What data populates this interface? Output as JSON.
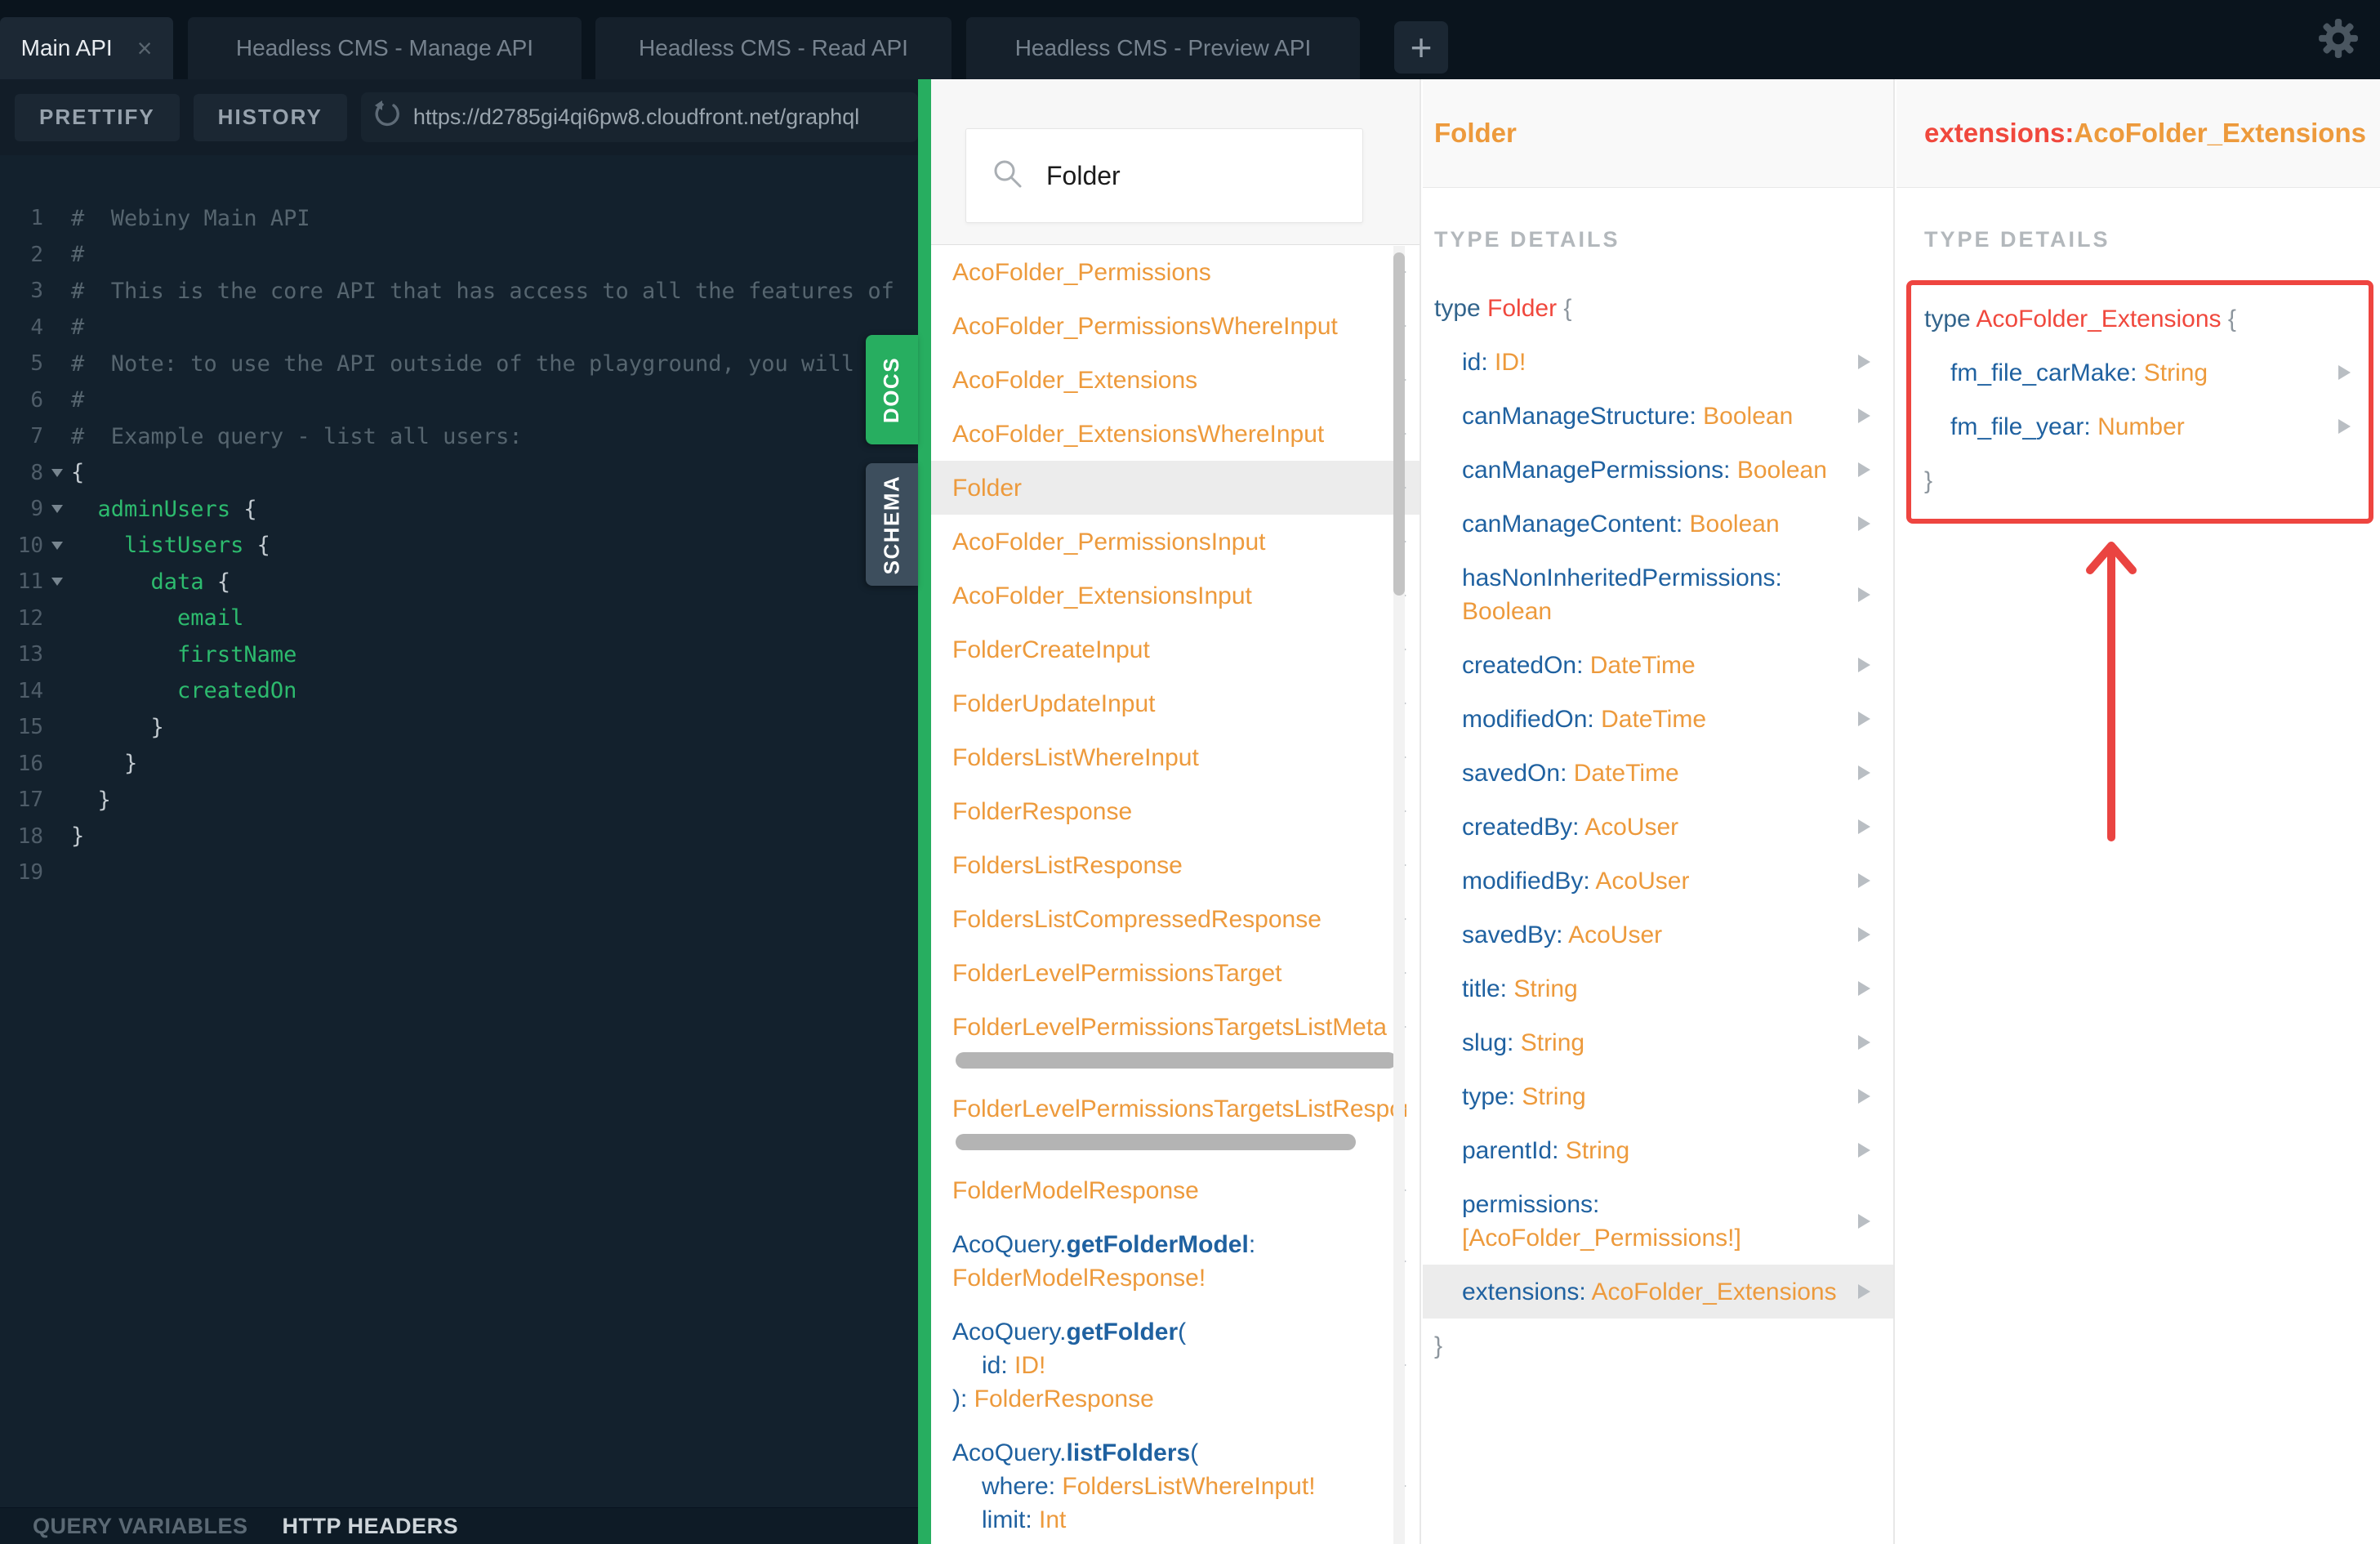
{
  "colors": {
    "accent_green": "#27ae60",
    "type_orange": "#ed9a3c",
    "field_blue": "#1f61a0",
    "keyword_red": "#f0483d",
    "highlight_red": "#ee4540",
    "editor_green": "#2dbb6e",
    "dark_bg": "#13212d"
  },
  "tabs": {
    "items": [
      {
        "label": "Main API",
        "active": true,
        "closable": true
      },
      {
        "label": "Headless CMS - Manage API",
        "active": false,
        "closable": false
      },
      {
        "label": "Headless CMS - Read API",
        "active": false,
        "closable": false
      },
      {
        "label": "Headless CMS - Preview API",
        "active": false,
        "closable": false
      }
    ],
    "close_label": "×",
    "add_label": "+"
  },
  "toolbar": {
    "prettify_label": "PRETTIFY",
    "history_label": "HISTORY",
    "url": "https://d2785gi4qi6pw8.cloudfront.net/graphql"
  },
  "footer": {
    "query_variables": "QUERY VARIABLES",
    "http_headers": "HTTP HEADERS"
  },
  "side_tabs": {
    "docs": "DOCS",
    "schema": "SCHEMA"
  },
  "editor": {
    "lines": [
      {
        "n": "1",
        "fold": false,
        "seg": [
          {
            "t": "#  Webiny Main API",
            "c": "cm"
          }
        ]
      },
      {
        "n": "2",
        "fold": false,
        "seg": [
          {
            "t": "#",
            "c": "cm"
          }
        ]
      },
      {
        "n": "3",
        "fold": false,
        "seg": [
          {
            "t": "#  This is the core API that has access to all the features of",
            "c": "cm"
          }
        ]
      },
      {
        "n": "4",
        "fold": false,
        "seg": [
          {
            "t": "#",
            "c": "cm"
          }
        ]
      },
      {
        "n": "5",
        "fold": false,
        "seg": [
          {
            "t": "#  Note: to use the API outside of the playground, you will need",
            "c": "cm"
          }
        ]
      },
      {
        "n": "6",
        "fold": false,
        "seg": [
          {
            "t": "#",
            "c": "cm"
          }
        ]
      },
      {
        "n": "7",
        "fold": false,
        "seg": [
          {
            "t": "#  Example query - list all users:",
            "c": "cm"
          }
        ]
      },
      {
        "n": "8",
        "fold": true,
        "seg": [
          {
            "t": "{",
            "c": "pn"
          }
        ]
      },
      {
        "n": "9",
        "fold": true,
        "seg": [
          {
            "t": "  ",
            "c": "pn"
          },
          {
            "t": "adminUsers",
            "c": "gr"
          },
          {
            "t": " {",
            "c": "pn"
          }
        ]
      },
      {
        "n": "10",
        "fold": true,
        "seg": [
          {
            "t": "    ",
            "c": "pn"
          },
          {
            "t": "listUsers",
            "c": "gr"
          },
          {
            "t": " {",
            "c": "pn"
          }
        ]
      },
      {
        "n": "11",
        "fold": true,
        "seg": [
          {
            "t": "      ",
            "c": "pn"
          },
          {
            "t": "data",
            "c": "gr"
          },
          {
            "t": " {",
            "c": "pn"
          }
        ]
      },
      {
        "n": "12",
        "fold": false,
        "seg": [
          {
            "t": "        ",
            "c": "pn"
          },
          {
            "t": "email",
            "c": "gr"
          }
        ]
      },
      {
        "n": "13",
        "fold": false,
        "seg": [
          {
            "t": "        ",
            "c": "pn"
          },
          {
            "t": "firstName",
            "c": "gr"
          }
        ]
      },
      {
        "n": "14",
        "fold": false,
        "seg": [
          {
            "t": "        ",
            "c": "pn"
          },
          {
            "t": "createdOn",
            "c": "gr"
          }
        ]
      },
      {
        "n": "15",
        "fold": false,
        "seg": [
          {
            "t": "      }",
            "c": "pn"
          }
        ]
      },
      {
        "n": "16",
        "fold": false,
        "seg": [
          {
            "t": "    }",
            "c": "pn"
          }
        ]
      },
      {
        "n": "17",
        "fold": false,
        "seg": [
          {
            "t": "  }",
            "c": "pn"
          }
        ]
      },
      {
        "n": "18",
        "fold": false,
        "seg": [
          {
            "t": "}",
            "c": "pn"
          }
        ]
      },
      {
        "n": "19",
        "fold": false,
        "seg": []
      }
    ]
  },
  "docs": {
    "search_value": "Folder",
    "list": [
      {
        "arrow": true,
        "lines": [
          {
            "seg": [
              {
                "t": "AcoFolder_Permissions",
                "c": "or"
              }
            ]
          }
        ]
      },
      {
        "arrow": true,
        "lines": [
          {
            "seg": [
              {
                "t": "AcoFolder_PermissionsWhereInput",
                "c": "or"
              }
            ]
          }
        ]
      },
      {
        "arrow": true,
        "lines": [
          {
            "seg": [
              {
                "t": "AcoFolder_Extensions",
                "c": "or"
              }
            ]
          }
        ]
      },
      {
        "arrow": true,
        "lines": [
          {
            "seg": [
              {
                "t": "AcoFolder_ExtensionsWhereInput",
                "c": "or"
              }
            ]
          }
        ]
      },
      {
        "arrow": true,
        "hl": true,
        "lines": [
          {
            "seg": [
              {
                "t": "Folder",
                "c": "or"
              }
            ]
          }
        ]
      },
      {
        "arrow": true,
        "lines": [
          {
            "seg": [
              {
                "t": "AcoFolder_PermissionsInput",
                "c": "or"
              }
            ]
          }
        ]
      },
      {
        "arrow": true,
        "lines": [
          {
            "seg": [
              {
                "t": "AcoFolder_ExtensionsInput",
                "c": "or"
              }
            ]
          }
        ]
      },
      {
        "arrow": true,
        "lines": [
          {
            "seg": [
              {
                "t": "FolderCreateInput",
                "c": "or"
              }
            ]
          }
        ]
      },
      {
        "arrow": true,
        "lines": [
          {
            "seg": [
              {
                "t": "FolderUpdateInput",
                "c": "or"
              }
            ]
          }
        ]
      },
      {
        "arrow": true,
        "lines": [
          {
            "seg": [
              {
                "t": "FoldersListWhereInput",
                "c": "or"
              }
            ]
          }
        ]
      },
      {
        "arrow": true,
        "lines": [
          {
            "seg": [
              {
                "t": "FolderResponse",
                "c": "or"
              }
            ]
          }
        ]
      },
      {
        "arrow": true,
        "lines": [
          {
            "seg": [
              {
                "t": "FoldersListResponse",
                "c": "or"
              }
            ]
          }
        ]
      },
      {
        "arrow": true,
        "lines": [
          {
            "seg": [
              {
                "t": "FoldersListCompressedResponse",
                "c": "or"
              }
            ]
          }
        ]
      },
      {
        "arrow": true,
        "lines": [
          {
            "seg": [
              {
                "t": "FolderLevelPermissionsTarget",
                "c": "or"
              }
            ]
          }
        ]
      },
      {
        "arrow": true,
        "hbar": true,
        "hbarw": 540,
        "lines": [
          {
            "seg": [
              {
                "t": "FolderLevelPermissionsTargetsListMeta",
                "c": "or"
              }
            ]
          }
        ]
      },
      {
        "arrow": true,
        "hbar": true,
        "hbarw": 490,
        "lines": [
          {
            "seg": [
              {
                "t": "FolderLevelPermissionsTargetsListResponse",
                "c": "or"
              }
            ]
          }
        ]
      },
      {
        "arrow": true,
        "lines": [
          {
            "seg": [
              {
                "t": "FolderModelResponse",
                "c": "or"
              }
            ]
          }
        ]
      },
      {
        "arrow": true,
        "lines": [
          {
            "seg": [
              {
                "t": "AcoQuery.",
                "c": "bl"
              },
              {
                "t": "getFolderModel",
                "c": "bb"
              },
              {
                "t": ":",
                "c": "bl"
              }
            ]
          },
          {
            "seg": [
              {
                "t": "FolderModelResponse!",
                "c": "or"
              }
            ]
          }
        ]
      },
      {
        "arrow": true,
        "lines": [
          {
            "seg": [
              {
                "t": "AcoQuery.",
                "c": "bl"
              },
              {
                "t": "getFolder",
                "c": "bb"
              },
              {
                "t": "(",
                "c": "bl"
              }
            ]
          },
          {
            "ind": true,
            "seg": [
              {
                "t": "id: ",
                "c": "bl"
              },
              {
                "t": "ID!",
                "c": "or"
              }
            ]
          },
          {
            "seg": [
              {
                "t": "): ",
                "c": "bl"
              },
              {
                "t": "FolderResponse",
                "c": "or"
              }
            ]
          }
        ]
      },
      {
        "arrow": true,
        "lines": [
          {
            "seg": [
              {
                "t": "AcoQuery.",
                "c": "bl"
              },
              {
                "t": "listFolders",
                "c": "bb"
              },
              {
                "t": "(",
                "c": "bl"
              }
            ]
          },
          {
            "ind": true,
            "seg": [
              {
                "t": "where: ",
                "c": "bl"
              },
              {
                "t": "FoldersListWhereInput!",
                "c": "or"
              }
            ]
          },
          {
            "ind": true,
            "seg": [
              {
                "t": "limit: ",
                "c": "bl"
              },
              {
                "t": "Int",
                "c": "or"
              }
            ]
          }
        ]
      }
    ]
  },
  "type_panel": {
    "header": "Folder",
    "section_label": "TYPE DETAILS",
    "rows": [
      {
        "lines": [
          {
            "seg": [
              {
                "t": "type ",
                "c": "kw"
              },
              {
                "t": "Folder ",
                "c": "rd"
              },
              {
                "t": "{",
                "c": "br"
              }
            ]
          }
        ]
      },
      {
        "f": true,
        "arrow": true,
        "lines": [
          {
            "seg": [
              {
                "t": "id: ",
                "c": "bl"
              },
              {
                "t": "ID!",
                "c": "or"
              }
            ]
          }
        ]
      },
      {
        "f": true,
        "arrow": true,
        "lines": [
          {
            "seg": [
              {
                "t": "canManageStructure: ",
                "c": "bl"
              },
              {
                "t": "Boolean",
                "c": "or"
              }
            ]
          }
        ]
      },
      {
        "f": true,
        "arrow": true,
        "lines": [
          {
            "seg": [
              {
                "t": "canManagePermissions: ",
                "c": "bl"
              },
              {
                "t": "Boolean",
                "c": "or"
              }
            ]
          }
        ]
      },
      {
        "f": true,
        "arrow": true,
        "lines": [
          {
            "seg": [
              {
                "t": "canManageContent: ",
                "c": "bl"
              },
              {
                "t": "Boolean",
                "c": "or"
              }
            ]
          }
        ]
      },
      {
        "f": true,
        "arrow": true,
        "lines": [
          {
            "seg": [
              {
                "t": "hasNonInheritedPermissions:",
                "c": "bl"
              }
            ]
          },
          {
            "seg": [
              {
                "t": "Boolean",
                "c": "or"
              }
            ]
          }
        ]
      },
      {
        "f": true,
        "arrow": true,
        "lines": [
          {
            "seg": [
              {
                "t": "createdOn: ",
                "c": "bl"
              },
              {
                "t": "DateTime",
                "c": "or"
              }
            ]
          }
        ]
      },
      {
        "f": true,
        "arrow": true,
        "lines": [
          {
            "seg": [
              {
                "t": "modifiedOn: ",
                "c": "bl"
              },
              {
                "t": "DateTime",
                "c": "or"
              }
            ]
          }
        ]
      },
      {
        "f": true,
        "arrow": true,
        "lines": [
          {
            "seg": [
              {
                "t": "savedOn: ",
                "c": "bl"
              },
              {
                "t": "DateTime",
                "c": "or"
              }
            ]
          }
        ]
      },
      {
        "f": true,
        "arrow": true,
        "lines": [
          {
            "seg": [
              {
                "t": "createdBy: ",
                "c": "bl"
              },
              {
                "t": "AcoUser",
                "c": "or"
              }
            ]
          }
        ]
      },
      {
        "f": true,
        "arrow": true,
        "lines": [
          {
            "seg": [
              {
                "t": "modifiedBy: ",
                "c": "bl"
              },
              {
                "t": "AcoUser",
                "c": "or"
              }
            ]
          }
        ]
      },
      {
        "f": true,
        "arrow": true,
        "lines": [
          {
            "seg": [
              {
                "t": "savedBy: ",
                "c": "bl"
              },
              {
                "t": "AcoUser",
                "c": "or"
              }
            ]
          }
        ]
      },
      {
        "f": true,
        "arrow": true,
        "lines": [
          {
            "seg": [
              {
                "t": "title: ",
                "c": "bl"
              },
              {
                "t": "String",
                "c": "or"
              }
            ]
          }
        ]
      },
      {
        "f": true,
        "arrow": true,
        "lines": [
          {
            "seg": [
              {
                "t": "slug: ",
                "c": "bl"
              },
              {
                "t": "String",
                "c": "or"
              }
            ]
          }
        ]
      },
      {
        "f": true,
        "arrow": true,
        "lines": [
          {
            "seg": [
              {
                "t": "type: ",
                "c": "bl"
              },
              {
                "t": "String",
                "c": "or"
              }
            ]
          }
        ]
      },
      {
        "f": true,
        "arrow": true,
        "lines": [
          {
            "seg": [
              {
                "t": "parentId: ",
                "c": "bl"
              },
              {
                "t": "String",
                "c": "or"
              }
            ]
          }
        ]
      },
      {
        "f": true,
        "arrow": true,
        "lines": [
          {
            "seg": [
              {
                "t": "permissions:",
                "c": "bl"
              }
            ]
          },
          {
            "seg": [
              {
                "t": "[AcoFolder_Permissions!]",
                "c": "or"
              }
            ]
          }
        ]
      },
      {
        "f": true,
        "arrow": true,
        "hl": true,
        "lines": [
          {
            "seg": [
              {
                "t": "extensions: ",
                "c": "bl"
              },
              {
                "t": "AcoFolder_Extensions",
                "c": "or"
              }
            ]
          }
        ]
      },
      {
        "lines": [
          {
            "seg": [
              {
                "t": "}",
                "c": "br"
              }
            ]
          }
        ]
      }
    ]
  },
  "ext_panel": {
    "header_field": "extensions: ",
    "header_type": "AcoFolder_Extensions",
    "section_label": "TYPE DETAILS",
    "rows": [
      {
        "lines": [
          {
            "seg": [
              {
                "t": "type ",
                "c": "kw"
              },
              {
                "t": "AcoFolder_Extensions ",
                "c": "rd"
              },
              {
                "t": "{",
                "c": "br"
              }
            ]
          }
        ]
      },
      {
        "f": true,
        "arrow": true,
        "lines": [
          {
            "seg": [
              {
                "t": "fm_file_carMake: ",
                "c": "bl"
              },
              {
                "t": "String",
                "c": "or"
              }
            ]
          }
        ]
      },
      {
        "f": true,
        "arrow": true,
        "lines": [
          {
            "seg": [
              {
                "t": "fm_file_year: ",
                "c": "bl"
              },
              {
                "t": "Number",
                "c": "or"
              }
            ]
          }
        ]
      },
      {
        "lines": [
          {
            "seg": [
              {
                "t": "}",
                "c": "br"
              }
            ]
          }
        ]
      }
    ]
  }
}
